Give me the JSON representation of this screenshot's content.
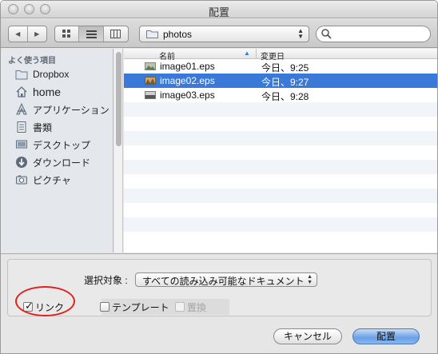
{
  "window": {
    "title": "配置"
  },
  "toolbar": {
    "back_label": "◀",
    "forward_label": "▶",
    "path_popup": "photos"
  },
  "sidebar": {
    "heading": "よく使う項目",
    "items": [
      {
        "label": "Dropbox",
        "icon": "dropbox-folder-icon"
      },
      {
        "label": "home",
        "icon": "home-icon"
      },
      {
        "label": "アプリケーション",
        "icon": "applications-icon"
      },
      {
        "label": "書類",
        "icon": "documents-icon"
      },
      {
        "label": "デスクトップ",
        "icon": "desktop-icon"
      },
      {
        "label": "ダウンロード",
        "icon": "downloads-icon"
      },
      {
        "label": "ピクチャ",
        "icon": "pictures-icon"
      }
    ]
  },
  "filelist": {
    "columns": {
      "name": "名前",
      "date": "変更日"
    },
    "rows": [
      {
        "name": "image01.eps",
        "date": "今日、9:25",
        "selected": false
      },
      {
        "name": "image02.eps",
        "date": "今日、9:27",
        "selected": true
      },
      {
        "name": "image03.eps",
        "date": "今日、9:28",
        "selected": false
      }
    ]
  },
  "options": {
    "filter_label": "選択対象 :",
    "filter_value": "すべての読み込み可能なドキュメント",
    "link_label": "リンク",
    "link_checked": true,
    "template_label": "テンプレート",
    "template_checked": false,
    "replace_label": "置換",
    "replace_checked": false
  },
  "buttons": {
    "cancel": "キャンセル",
    "place": "配置"
  },
  "colors": {
    "selection": "#3a79d8",
    "annotation": "#e0201c"
  }
}
